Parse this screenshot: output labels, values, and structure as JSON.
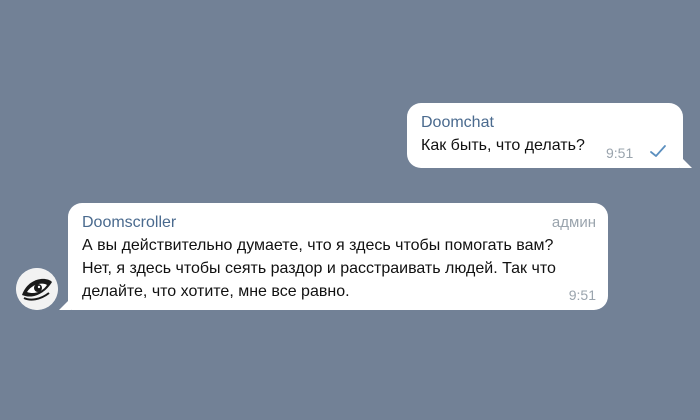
{
  "messages": {
    "outgoing": {
      "sender": "Doomchat",
      "text": "Как быть, что делать?",
      "time": "9:51",
      "status_icon": "read-check-icon"
    },
    "incoming": {
      "sender": "Doomscroller",
      "role": "админ",
      "lines": [
        "А вы действительно думаете, что я здесь чтобы помогать вам?",
        "Нет, я здесь чтобы сеять раздор и расстраивать людей. Так что",
        "делайте, что хотите, мне все равно."
      ],
      "time": "9:51",
      "avatar_icon": "eye-avatar-icon"
    }
  },
  "colors": {
    "background": "#728196",
    "bubble": "#ffffff",
    "sender_name": "#4a6a8e",
    "meta_text": "#9aa4ad"
  }
}
